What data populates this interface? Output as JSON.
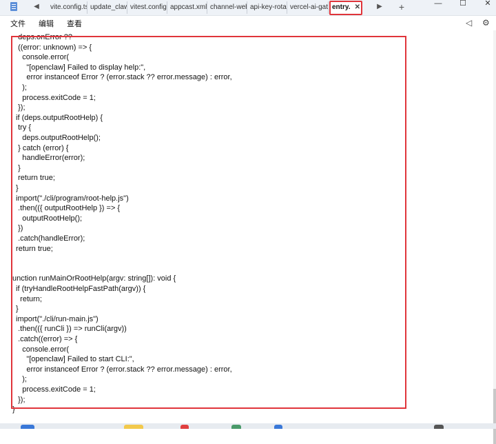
{
  "tabs": [
    {
      "label": "vite.config.ts"
    },
    {
      "label": "update_claw"
    },
    {
      "label": "vitest.config."
    },
    {
      "label": "appcast.xml"
    },
    {
      "label": "channel-web"
    },
    {
      "label": "api-key-rota"
    },
    {
      "label": "vercel-ai-gat"
    },
    {
      "label": "entry."
    }
  ],
  "tab_close_glyph": "✕",
  "new_tab_glyph": "+",
  "nav": {
    "left": "◀",
    "right": "▶"
  },
  "window": {
    "minimize": "—",
    "maximize": "☐",
    "close": "✕"
  },
  "menu": {
    "file": "文件",
    "edit": "编辑",
    "view": "查看"
  },
  "code_lines": [
    "  deps.onError ??",
    "  ((error: unknown) => {",
    "    console.error(",
    "      \"[openclaw] Failed to display help:\",",
    "      error instanceof Error ? (error.stack ?? error.message) : error,",
    "    );",
    "    process.exitCode = 1;",
    "  });",
    " if (deps.outputRootHelp) {",
    "  try {",
    "    deps.outputRootHelp();",
    "  } catch (error) {",
    "    handleError(error);",
    "  }",
    "  return true;",
    " }",
    " import(\"./cli/program/root-help.js\")",
    "  .then(({ outputRootHelp }) => {",
    "    outputRootHelp();",
    "  })",
    "  .catch(handleError);",
    " return true;",
    "",
    "",
    "unction runMainOrRootHelp(argv: string[]): void {",
    " if (tryHandleRootHelpFastPath(argv)) {",
    "   return;",
    " }",
    " import(\"./cli/run-main.js\")",
    "  .then(({ runCli }) => runCli(argv))",
    "  .catch((error) => {",
    "    console.error(",
    "      \"[openclaw] Failed to start CLI:\",",
    "      error instanceof Error ? (error.stack ?? error.message) : error,",
    "    );",
    "    process.exitCode = 1;",
    "  });",
    "}"
  ],
  "colors": {
    "highlight": "#e0343a",
    "tabbar": "#eef2f7"
  }
}
